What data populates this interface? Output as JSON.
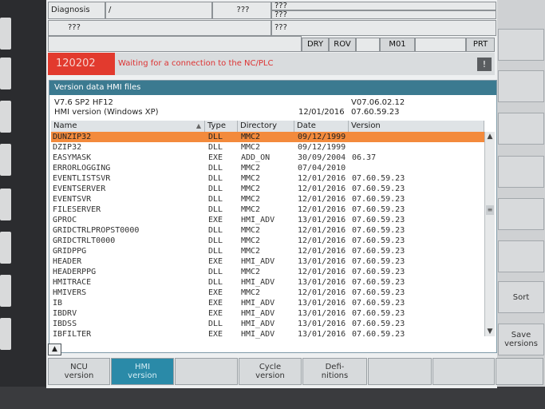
{
  "header": {
    "diagnosis_label": "Diagnosis",
    "slash": "/",
    "unknown": "???",
    "tags": [
      "DRY",
      "ROV",
      "M01",
      "PRT"
    ]
  },
  "alarm": {
    "number": "120202",
    "text": "Waiting for a connection to the NC/PLC",
    "ack": "!"
  },
  "panel": {
    "title": "Version data HMI files",
    "sw_version": "V7.6 SP2 HF12",
    "sw_version_id": "V07.06.02.12",
    "hmi_version_label": "HMI version (Windows XP)",
    "hmi_date": "12/01/2016",
    "hmi_version": "07.60.59.23",
    "columns": [
      "Name",
      "Type",
      "Directory",
      "Date",
      "Version"
    ],
    "rows": [
      {
        "name": "DUNZIP32",
        "type": "DLL",
        "dir": "MMC2",
        "date": "09/12/1999",
        "ver": ""
      },
      {
        "name": "DZIP32",
        "type": "DLL",
        "dir": "MMC2",
        "date": "09/12/1999",
        "ver": ""
      },
      {
        "name": "EASYMASK",
        "type": "EXE",
        "dir": "ADD_ON",
        "date": "30/09/2004",
        "ver": "06.37"
      },
      {
        "name": "ERRORLOGGING",
        "type": "DLL",
        "dir": "MMC2",
        "date": "07/04/2010",
        "ver": ""
      },
      {
        "name": "EVENTLISTSVR",
        "type": "DLL",
        "dir": "MMC2",
        "date": "12/01/2016",
        "ver": "07.60.59.23"
      },
      {
        "name": "EVENTSERVER",
        "type": "DLL",
        "dir": "MMC2",
        "date": "12/01/2016",
        "ver": "07.60.59.23"
      },
      {
        "name": "EVENTSVR",
        "type": "DLL",
        "dir": "MMC2",
        "date": "12/01/2016",
        "ver": "07.60.59.23"
      },
      {
        "name": "FILESERVER",
        "type": "DLL",
        "dir": "MMC2",
        "date": "12/01/2016",
        "ver": "07.60.59.23"
      },
      {
        "name": "GPROC",
        "type": "EXE",
        "dir": "HMI_ADV",
        "date": "13/01/2016",
        "ver": "07.60.59.23"
      },
      {
        "name": "GRIDCTRLPROPST0000",
        "type": "DLL",
        "dir": "MMC2",
        "date": "12/01/2016",
        "ver": "07.60.59.23"
      },
      {
        "name": "GRIDCTRLT0000",
        "type": "DLL",
        "dir": "MMC2",
        "date": "12/01/2016",
        "ver": "07.60.59.23"
      },
      {
        "name": "GRIDPPG",
        "type": "DLL",
        "dir": "MMC2",
        "date": "12/01/2016",
        "ver": "07.60.59.23"
      },
      {
        "name": "HEADER",
        "type": "EXE",
        "dir": "HMI_ADV",
        "date": "13/01/2016",
        "ver": "07.60.59.23"
      },
      {
        "name": "HEADERPPG",
        "type": "DLL",
        "dir": "MMC2",
        "date": "12/01/2016",
        "ver": "07.60.59.23"
      },
      {
        "name": "HMITRACE",
        "type": "DLL",
        "dir": "HMI_ADV",
        "date": "13/01/2016",
        "ver": "07.60.59.23"
      },
      {
        "name": "HMIVERS",
        "type": "EXE",
        "dir": "MMC2",
        "date": "12/01/2016",
        "ver": "07.60.59.23"
      },
      {
        "name": "IB",
        "type": "EXE",
        "dir": "HMI_ADV",
        "date": "13/01/2016",
        "ver": "07.60.59.23"
      },
      {
        "name": "IBDRV",
        "type": "EXE",
        "dir": "HMI_ADV",
        "date": "13/01/2016",
        "ver": "07.60.59.23"
      },
      {
        "name": "IBDSS",
        "type": "DLL",
        "dir": "HMI_ADV",
        "date": "13/01/2016",
        "ver": "07.60.59.23"
      },
      {
        "name": "IBFILTER",
        "type": "EXE",
        "dir": "HMI_ADV",
        "date": "13/01/2016",
        "ver": "07.60.59.23"
      }
    ]
  },
  "softkeys_bottom": [
    "NCU\nversion",
    "HMI\nversion",
    "",
    "Cycle\nversion",
    "Defi-\nnitions",
    "",
    "",
    ""
  ],
  "softkeys_right": [
    "",
    "",
    "",
    "",
    "",
    "",
    "Sort",
    "Save\nversions"
  ]
}
